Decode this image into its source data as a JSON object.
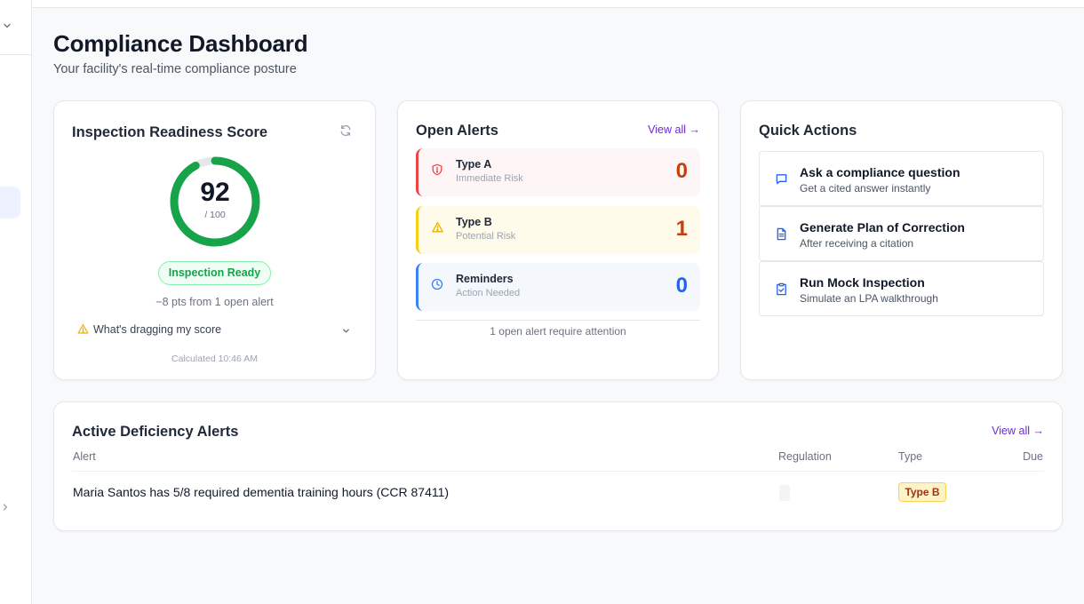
{
  "header": {
    "title": "Compliance Dashboard",
    "subtitle": "Your facility's real-time compliance posture"
  },
  "readiness": {
    "title": "Inspection Readiness Score",
    "score": "92",
    "max": "/ 100",
    "score_fraction": 0.92,
    "status": "Inspection Ready",
    "note": "−8 pts from 1 open alert",
    "drag_label": "What's dragging my score",
    "calculated": "Calculated 10:46 AM"
  },
  "open_alerts": {
    "title": "Open Alerts",
    "view_all": "View all →",
    "items": [
      {
        "name": "Type A",
        "sub": "Immediate Risk",
        "count": "0",
        "color": "#c2410c",
        "icon": "shield-alert-icon"
      },
      {
        "name": "Type B",
        "sub": "Potential Risk",
        "count": "1",
        "color": "#c2410c",
        "icon": "warning-triangle-icon"
      },
      {
        "name": "Reminders",
        "sub": "Action Needed",
        "count": "0",
        "color": "#2563eb",
        "icon": "clock-icon"
      }
    ],
    "footer": "1 open alert require attention"
  },
  "quick_actions": {
    "title": "Quick Actions",
    "items": [
      {
        "title": "Ask a compliance question",
        "sub": "Get a cited answer instantly",
        "icon": "chat-bubble-icon"
      },
      {
        "title": "Generate Plan of Correction",
        "sub": "After receiving a citation",
        "icon": "document-icon"
      },
      {
        "title": "Run Mock Inspection",
        "sub": "Simulate an LPA walkthrough",
        "icon": "clipboard-check-icon"
      }
    ]
  },
  "deficiency": {
    "title": "Active Deficiency Alerts",
    "view_all": "View all →",
    "columns": [
      "Alert",
      "Regulation",
      "Type",
      "Due"
    ],
    "rows": [
      {
        "alert": "Maria Santos has 5/8 required dementia training hours (CCR 87411)",
        "regulation": "",
        "type": "Type B",
        "due": ""
      }
    ]
  },
  "colors": {
    "accent": "#6d28d9",
    "success": "#16a34a",
    "danger": "#ef4444",
    "warning": "#facc15",
    "info": "#3b82f6"
  }
}
